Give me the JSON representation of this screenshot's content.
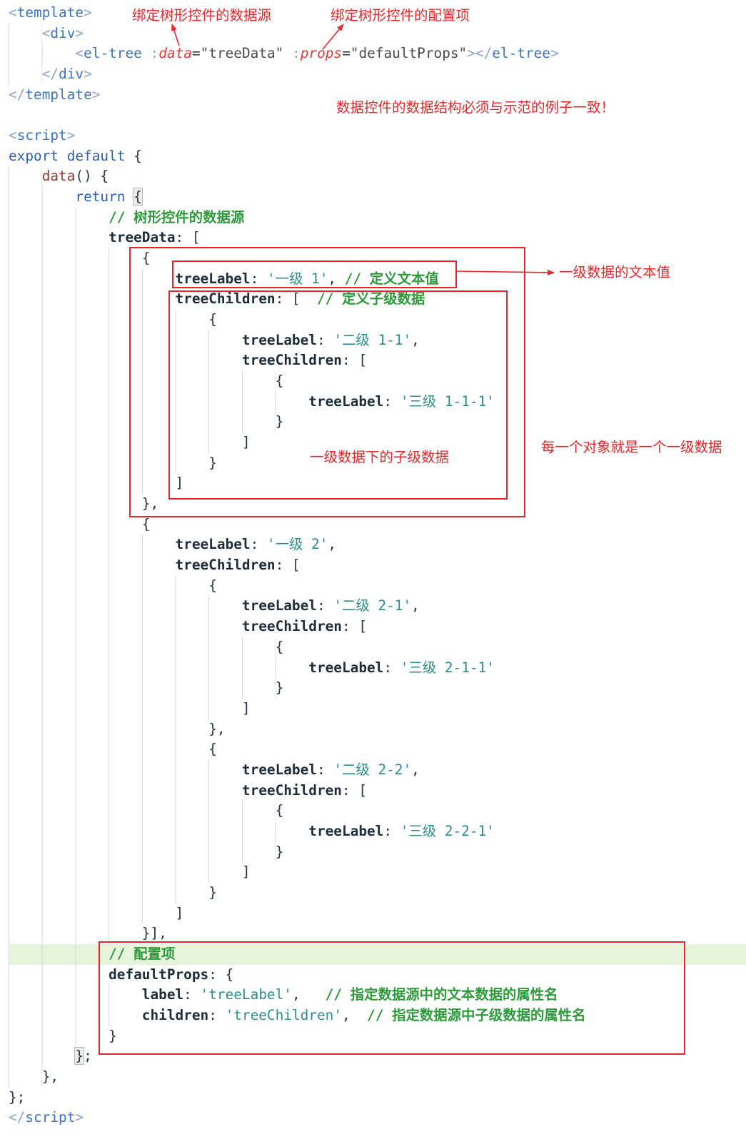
{
  "colors": {
    "annotation": "#e8252b",
    "active_line": "#e6f4dc"
  },
  "annotations": {
    "label_data_source": "绑定树形控件的数据源",
    "label_config": "绑定树形控件的配置项",
    "note_structure": "数据控件的数据结构必须与示范的例子一致！",
    "label_level1_text": "一级数据的文本值",
    "label_children": "一级数据下的子级数据",
    "label_each_object": "每一个对象就是一个一级数据"
  },
  "editor": {
    "lines": [
      {
        "tokens": [
          {
            "punct": "<"
          },
          {
            "tag": "template"
          },
          {
            "punct": ">"
          }
        ]
      },
      {
        "tokens": [
          {
            "ws": "    "
          },
          {
            "punct": "<"
          },
          {
            "tag": "div"
          },
          {
            "punct": ">"
          }
        ]
      },
      {
        "tokens": [
          {
            "ws": "        "
          },
          {
            "punct": "<"
          },
          {
            "tag": "el-tree"
          },
          {
            "plain": " "
          },
          {
            "punct": ":"
          },
          {
            "attr": "data"
          },
          {
            "plain": "="
          },
          {
            "attrval": "\"treeData\""
          },
          {
            "plain": " "
          },
          {
            "punct": ":"
          },
          {
            "attr": "props"
          },
          {
            "plain": "="
          },
          {
            "attrval": "\"defaultProps\""
          },
          {
            "punct": "></"
          },
          {
            "tag": "el-tree"
          },
          {
            "punct": ">"
          }
        ]
      },
      {
        "tokens": [
          {
            "ws": "    "
          },
          {
            "punct": "</"
          },
          {
            "tag": "div"
          },
          {
            "punct": ">"
          }
        ]
      },
      {
        "tokens": [
          {
            "punct": "</"
          },
          {
            "tag": "template"
          },
          {
            "punct": ">"
          }
        ]
      },
      {
        "tokens": []
      },
      {
        "tokens": [
          {
            "punct": "<"
          },
          {
            "tag": "script"
          },
          {
            "punct": ">"
          }
        ]
      },
      {
        "tokens": [
          {
            "kw": "export"
          },
          {
            "plain": " "
          },
          {
            "kw": "default"
          },
          {
            "plain": " {"
          }
        ]
      },
      {
        "tokens": [
          {
            "ws": "    "
          },
          {
            "fn": "data"
          },
          {
            "plain": "() {"
          }
        ]
      },
      {
        "tokens": [
          {
            "ws": "        "
          },
          {
            "kw": "return"
          },
          {
            "plain": " "
          },
          {
            "bm": "{"
          }
        ]
      },
      {
        "tokens": [
          {
            "ws": "            "
          },
          {
            "cm": "// 树形控件的数据源"
          }
        ]
      },
      {
        "tokens": [
          {
            "ws": "            "
          },
          {
            "key": "treeData"
          },
          {
            "plain": ": ["
          }
        ]
      },
      {
        "tokens": [
          {
            "ws": "                "
          },
          {
            "plain": "{"
          }
        ]
      },
      {
        "tokens": [
          {
            "ws": "                    "
          },
          {
            "key": "treeLabel"
          },
          {
            "plain": ": "
          },
          {
            "str": "'一级 1'"
          },
          {
            "plain": ", "
          },
          {
            "cm": "// 定义文本值"
          }
        ]
      },
      {
        "tokens": [
          {
            "ws": "                    "
          },
          {
            "key": "treeChildren"
          },
          {
            "plain": ": [  "
          },
          {
            "cm": "// 定义子级数据"
          }
        ]
      },
      {
        "tokens": [
          {
            "ws": "                        "
          },
          {
            "plain": "{"
          }
        ]
      },
      {
        "tokens": [
          {
            "ws": "                            "
          },
          {
            "key": "treeLabel"
          },
          {
            "plain": ": "
          },
          {
            "str": "'二级 1-1'"
          },
          {
            "plain": ","
          }
        ]
      },
      {
        "tokens": [
          {
            "ws": "                            "
          },
          {
            "key": "treeChildren"
          },
          {
            "plain": ": ["
          }
        ]
      },
      {
        "tokens": [
          {
            "ws": "                                "
          },
          {
            "plain": "{"
          }
        ]
      },
      {
        "tokens": [
          {
            "ws": "                                    "
          },
          {
            "key": "treeLabel"
          },
          {
            "plain": ": "
          },
          {
            "str": "'三级 1-1-1'"
          }
        ]
      },
      {
        "tokens": [
          {
            "ws": "                                "
          },
          {
            "plain": "}"
          }
        ]
      },
      {
        "tokens": [
          {
            "ws": "                            "
          },
          {
            "plain": "]"
          }
        ]
      },
      {
        "tokens": [
          {
            "ws": "                        "
          },
          {
            "plain": "}"
          }
        ]
      },
      {
        "tokens": [
          {
            "ws": "                    "
          },
          {
            "plain": "]"
          }
        ]
      },
      {
        "tokens": [
          {
            "ws": "                "
          },
          {
            "plain": "},"
          }
        ]
      },
      {
        "tokens": [
          {
            "ws": "                "
          },
          {
            "plain": "{"
          }
        ]
      },
      {
        "tokens": [
          {
            "ws": "                    "
          },
          {
            "key": "treeLabel"
          },
          {
            "plain": ": "
          },
          {
            "str": "'一级 2'"
          },
          {
            "plain": ","
          }
        ]
      },
      {
        "tokens": [
          {
            "ws": "                    "
          },
          {
            "key": "treeChildren"
          },
          {
            "plain": ": ["
          }
        ]
      },
      {
        "tokens": [
          {
            "ws": "                        "
          },
          {
            "plain": "{"
          }
        ]
      },
      {
        "tokens": [
          {
            "ws": "                            "
          },
          {
            "key": "treeLabel"
          },
          {
            "plain": ": "
          },
          {
            "str": "'二级 2-1'"
          },
          {
            "plain": ","
          }
        ]
      },
      {
        "tokens": [
          {
            "ws": "                            "
          },
          {
            "key": "treeChildren"
          },
          {
            "plain": ": ["
          }
        ]
      },
      {
        "tokens": [
          {
            "ws": "                                "
          },
          {
            "plain": "{"
          }
        ]
      },
      {
        "tokens": [
          {
            "ws": "                                    "
          },
          {
            "key": "treeLabel"
          },
          {
            "plain": ": "
          },
          {
            "str": "'三级 2-1-1'"
          }
        ]
      },
      {
        "tokens": [
          {
            "ws": "                                "
          },
          {
            "plain": "}"
          }
        ]
      },
      {
        "tokens": [
          {
            "ws": "                            "
          },
          {
            "plain": "]"
          }
        ]
      },
      {
        "tokens": [
          {
            "ws": "                        "
          },
          {
            "plain": "},"
          }
        ]
      },
      {
        "tokens": [
          {
            "ws": "                        "
          },
          {
            "plain": "{"
          }
        ]
      },
      {
        "tokens": [
          {
            "ws": "                            "
          },
          {
            "key": "treeLabel"
          },
          {
            "plain": ": "
          },
          {
            "str": "'二级 2-2'"
          },
          {
            "plain": ","
          }
        ]
      },
      {
        "tokens": [
          {
            "ws": "                            "
          },
          {
            "key": "treeChildren"
          },
          {
            "plain": ": ["
          }
        ]
      },
      {
        "tokens": [
          {
            "ws": "                                "
          },
          {
            "plain": "{"
          }
        ]
      },
      {
        "tokens": [
          {
            "ws": "                                    "
          },
          {
            "key": "treeLabel"
          },
          {
            "plain": ": "
          },
          {
            "str": "'三级 2-2-1'"
          }
        ]
      },
      {
        "tokens": [
          {
            "ws": "                                "
          },
          {
            "plain": "}"
          }
        ]
      },
      {
        "tokens": [
          {
            "ws": "                            "
          },
          {
            "plain": "]"
          }
        ]
      },
      {
        "tokens": [
          {
            "ws": "                        "
          },
          {
            "plain": "}"
          }
        ]
      },
      {
        "tokens": [
          {
            "ws": "                    "
          },
          {
            "plain": "]"
          }
        ]
      },
      {
        "tokens": [
          {
            "ws": "                "
          },
          {
            "plain": "}],"
          }
        ]
      },
      {
        "active": true,
        "tokens": [
          {
            "ws": "            "
          },
          {
            "cm": "// 配置项"
          }
        ]
      },
      {
        "tokens": [
          {
            "ws": "            "
          },
          {
            "key": "defaultProps"
          },
          {
            "plain": ": {"
          }
        ]
      },
      {
        "tokens": [
          {
            "ws": "                "
          },
          {
            "key": "label"
          },
          {
            "plain": ": "
          },
          {
            "str": "'treeLabel'"
          },
          {
            "plain": ",   "
          },
          {
            "cm": "// 指定数据源中的文本数据的属性名"
          }
        ]
      },
      {
        "tokens": [
          {
            "ws": "                "
          },
          {
            "key": "children"
          },
          {
            "plain": ": "
          },
          {
            "str": "'treeChildren'"
          },
          {
            "plain": ",  "
          },
          {
            "cm": "// 指定数据源中子级数据的属性名"
          }
        ]
      },
      {
        "tokens": [
          {
            "ws": "            "
          },
          {
            "plain": "}"
          }
        ]
      },
      {
        "tokens": [
          {
            "ws": "        "
          },
          {
            "bm": "}"
          },
          {
            "plain": ";"
          }
        ]
      },
      {
        "tokens": [
          {
            "ws": "    "
          },
          {
            "plain": "},"
          }
        ]
      },
      {
        "tokens": [
          {
            "plain": "};"
          }
        ]
      },
      {
        "tokens": [
          {
            "punct": "</"
          },
          {
            "tag": "script"
          },
          {
            "punct": ">"
          }
        ]
      }
    ]
  }
}
